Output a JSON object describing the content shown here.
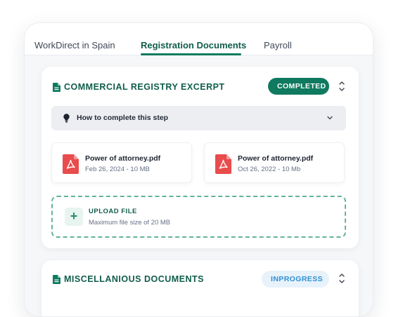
{
  "tabs": [
    {
      "label": "WorkDirect in Spain",
      "active": false
    },
    {
      "label": "Registration Documents",
      "active": true
    },
    {
      "label": "Payroll",
      "active": false
    }
  ],
  "commercial_registry": {
    "title": "COMMERCIAL REGISTRY EXCERPT",
    "status": "COMPLETED",
    "header_icon": "document-icon",
    "toggle_icon": "collapse-chevron-icon",
    "howto": {
      "label": "How to complete this step",
      "icon": "lightbulb-icon",
      "expand_icon": "chevron-down-icon"
    },
    "files": [
      {
        "name": "Power of attorney.pdf",
        "meta": "Feb 26, 2024 - 10 MB",
        "icon": "pdf-icon"
      },
      {
        "name": "Power of attorney.pdf",
        "meta": "Oct 26, 2022 - 10 Mb",
        "icon": "pdf-icon"
      }
    ],
    "upload": {
      "title": "UPLOAD FILE",
      "subtitle": "Maximum file size of 20 MB",
      "icon": "plus-icon",
      "icon_text": "+"
    }
  },
  "misc_documents": {
    "title": "MISCELLANIOUS DOCUMENTS",
    "status": "INPROGRESS",
    "header_icon": "document-icon",
    "toggle_icon": "collapse-chevron-icon"
  },
  "colors": {
    "brand_green": "#0f7a5f",
    "completed_badge": "#0f7a5f",
    "inprogress_badge_bg": "#e7f2fb",
    "inprogress_badge_text": "#2f8fd3",
    "pdf_red": "#e84c4c",
    "upload_border": "#61b49c"
  }
}
